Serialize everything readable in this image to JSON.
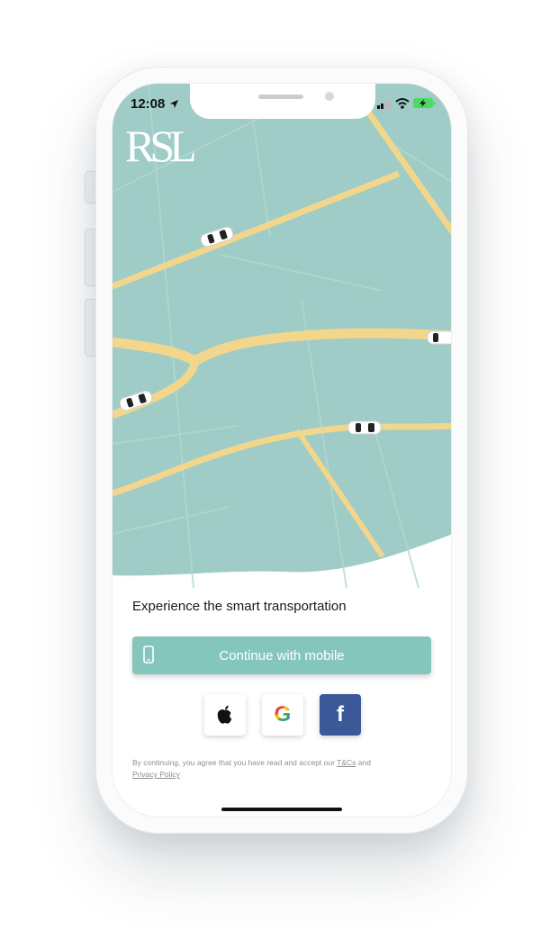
{
  "status_bar": {
    "time": "12:08"
  },
  "brand": {
    "logo_text": "RSL"
  },
  "main": {
    "tagline": "Experience the smart transportation",
    "continue_mobile_label": "Continue with mobile"
  },
  "social_logins": [
    {
      "name": "apple",
      "icon": "apple-icon"
    },
    {
      "name": "google",
      "icon": "google-icon",
      "letter": "G"
    },
    {
      "name": "facebook",
      "icon": "facebook-icon",
      "letter": "f"
    }
  ],
  "terms": {
    "prefix": "By continuing, you agree that you have read and accept our",
    "tnc_link": "T&Cs",
    "and": "and",
    "privacy_link": "Privacy Policy"
  },
  "colors": {
    "map_background": "#9fccc6",
    "road": "#f2d68c",
    "accent": "#84c6bb",
    "facebook": "#3b5998"
  }
}
